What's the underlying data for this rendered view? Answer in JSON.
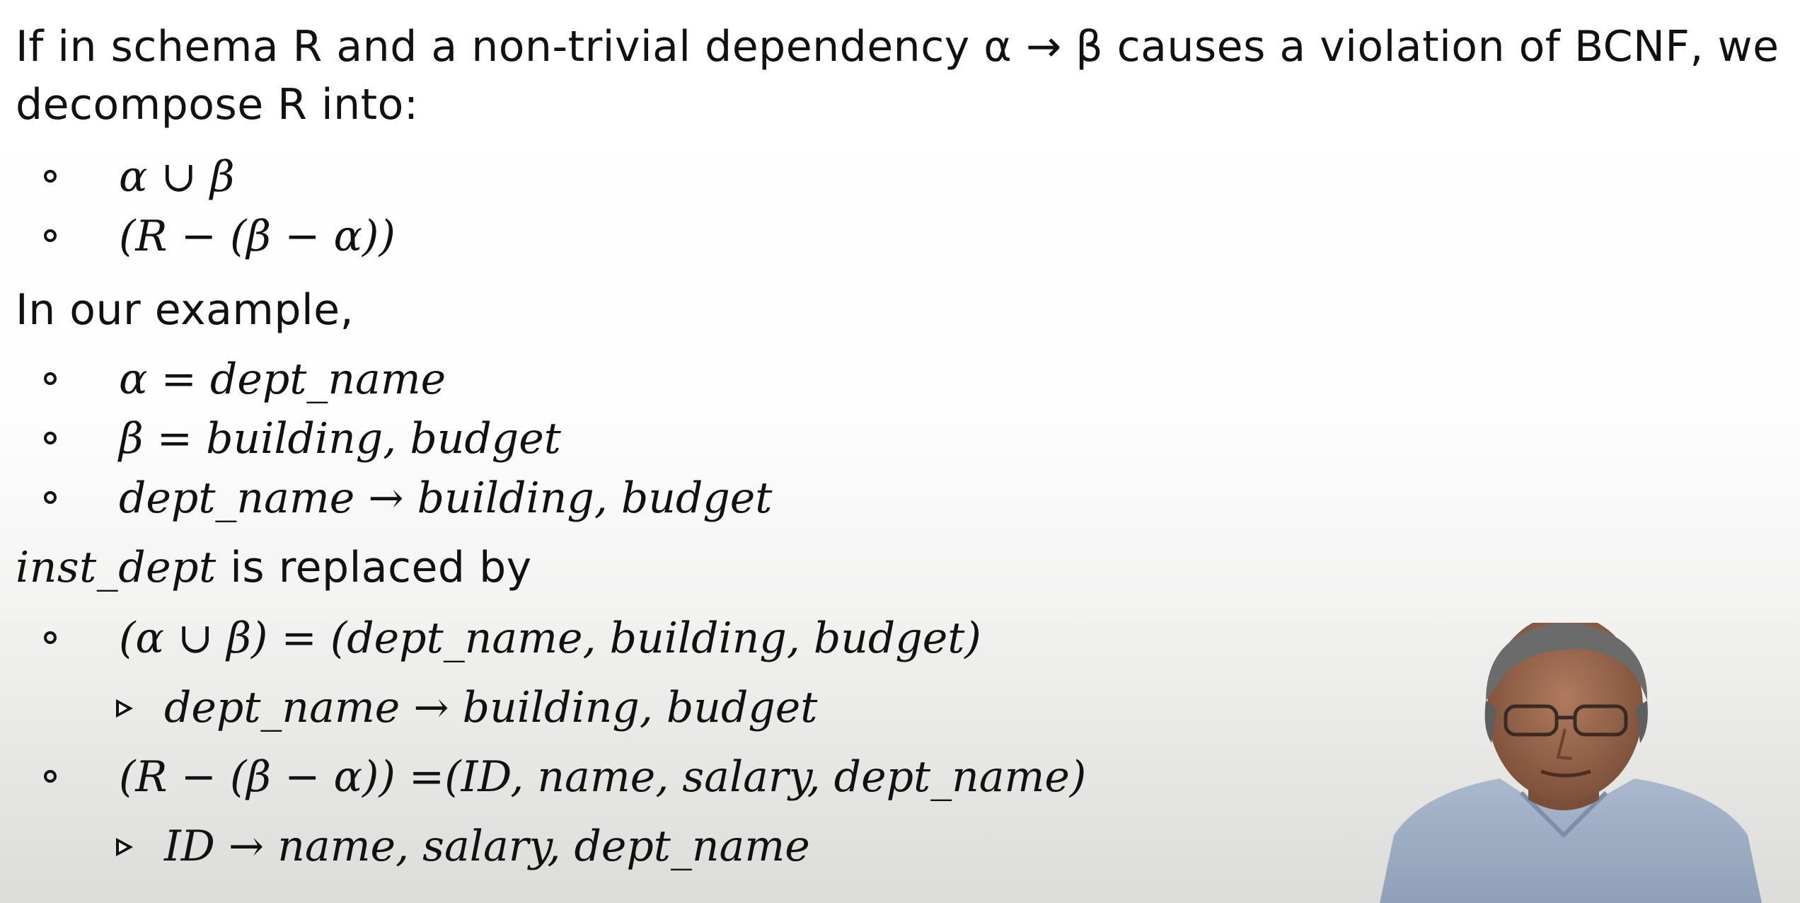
{
  "intro": {
    "line1": "If in schema R and a non-trivial dependency α → β causes a violation of BCNF, we",
    "line2": "decompose R into:"
  },
  "decompose_items": [
    "α ∪ β",
    "(R − (β − α))"
  ],
  "example_heading": "In our example,",
  "example_items": [
    "α = dept_name",
    "β = building, budget",
    "dept_name → building, budget"
  ],
  "replaced_heading": {
    "relation": "inst_dept",
    "text": " is replaced by"
  },
  "replacements": [
    {
      "item": "(α ∪ β) = (dept_name, building, budget)",
      "sub": "dept_name → building, budget"
    },
    {
      "item": "(R − (β − α)) =(ID, name, salary, dept_name)",
      "sub": "ID → name, salary, dept_name"
    }
  ]
}
